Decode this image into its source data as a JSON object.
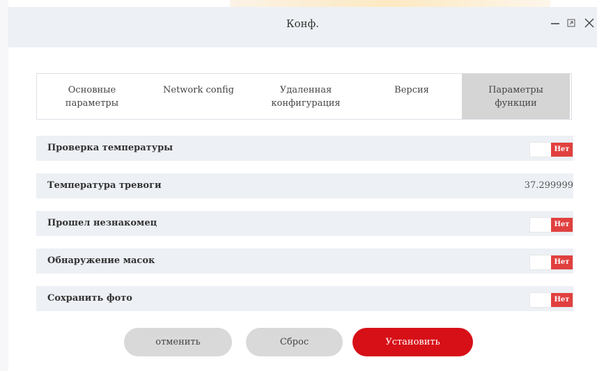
{
  "window": {
    "title": "Конф."
  },
  "tabs": [
    {
      "label": "Основные\nпараметры",
      "active": false
    },
    {
      "label": "Network config",
      "active": false
    },
    {
      "label": "Удаленная\nконфигурация",
      "active": false
    },
    {
      "label": "Версия",
      "active": false
    },
    {
      "label": "Параметры\nфункции",
      "active": true
    }
  ],
  "settings": {
    "temperature_check": {
      "label": "Проверка температуры",
      "state": "Нет"
    },
    "alarm_temperature": {
      "label": "Температура тревоги",
      "value": "37.299999"
    },
    "stranger_passed": {
      "label": "Прошел незнакомец",
      "state": "Нет"
    },
    "mask_detection": {
      "label": "Обнаружение масок",
      "state": "Нет"
    },
    "save_photo": {
      "label": "Сохранить фото",
      "state": "Нет"
    }
  },
  "buttons": {
    "cancel": "отменить",
    "reset": "Сброс",
    "apply": "Установить"
  },
  "colors": {
    "accent_red": "#d70f17",
    "toggle_off": "#e0403f",
    "row_background": "#edf0f5",
    "active_tab": "#d5d5d5"
  },
  "icons": {
    "minimize": "minimize-icon",
    "maximize": "maximize-icon",
    "close": "close-icon"
  }
}
